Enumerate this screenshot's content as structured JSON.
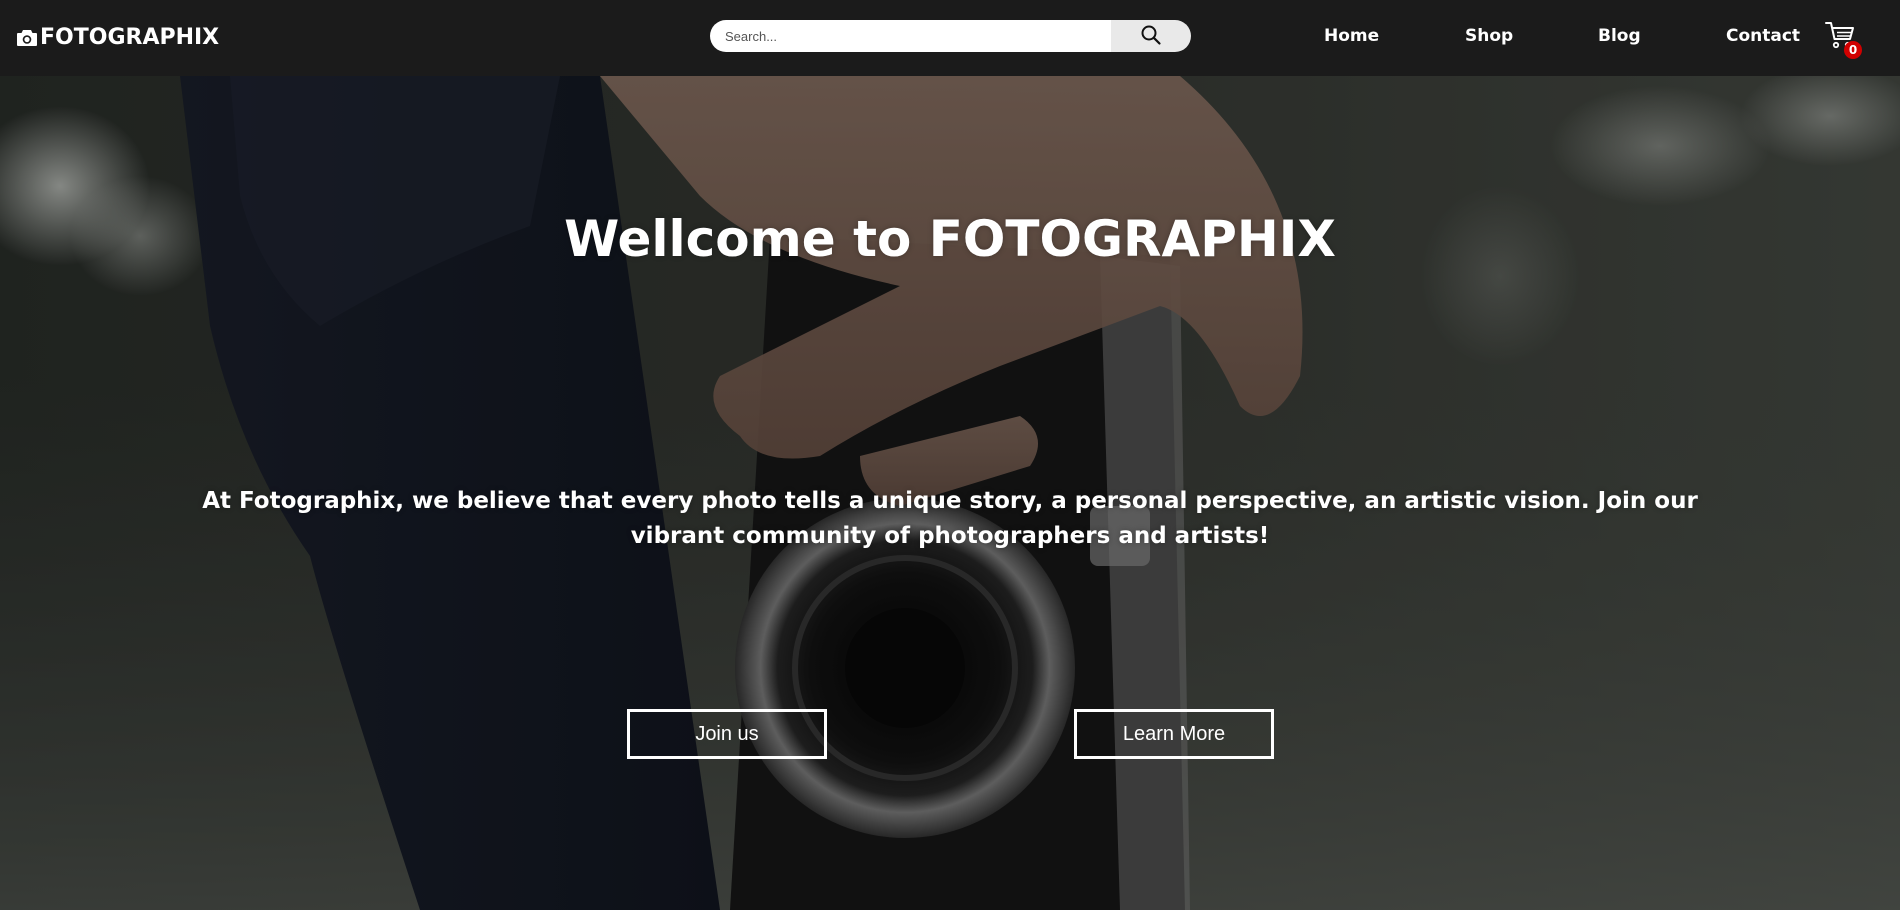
{
  "header": {
    "brand": "FOTOGRAPHIX",
    "brand_icon": "camera-icon",
    "search": {
      "placeholder": "Search...",
      "value": "",
      "button_icon": "search-icon"
    },
    "nav": [
      {
        "label": "Home"
      },
      {
        "label": "Shop"
      },
      {
        "label": "Blog"
      },
      {
        "label": "Contact"
      }
    ],
    "cart": {
      "icon": "cart-icon",
      "count": "0",
      "badge_color": "#d10000"
    }
  },
  "hero": {
    "title": "Wellcome to FOTOGRAPHIX",
    "text": "At Fotographix, we believe that every photo tells a unique story, a personal perspective, an artistic vision. Join our vibrant community of photographers and artists!",
    "buttons": {
      "join": "Join us",
      "learn": "Learn More"
    }
  },
  "colors": {
    "navbar_bg": "#1b1b1b",
    "text": "#ffffff"
  }
}
